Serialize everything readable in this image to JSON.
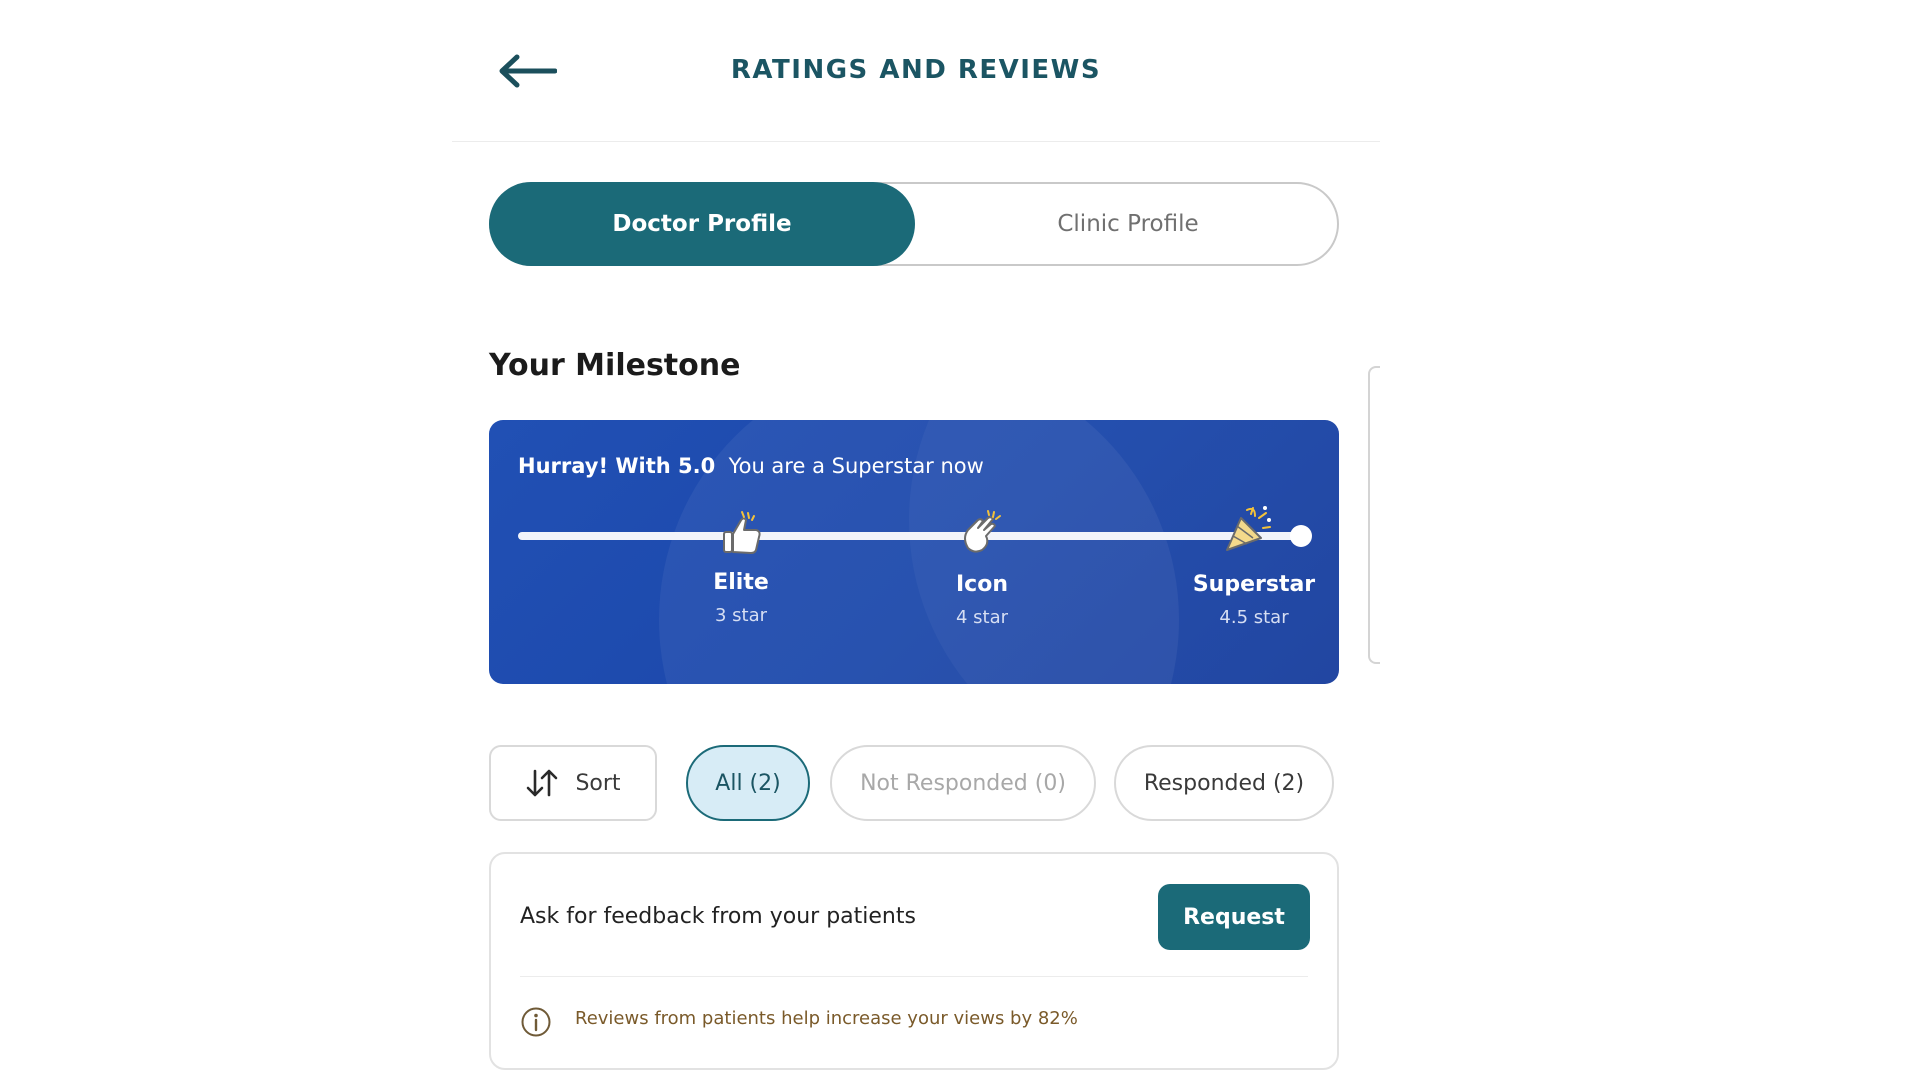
{
  "header": {
    "title": "RATINGS AND REVIEWS",
    "back_icon": "arrow-left-icon"
  },
  "tabs": [
    {
      "label": "Doctor Profile",
      "active": true
    },
    {
      "label": "Clinic Profile",
      "active": false
    }
  ],
  "milestone": {
    "section_title": "Your Milestone",
    "banner_prefix": "Hurray! With 5.0",
    "banner_suffix": "You are a Superstar now",
    "levels": [
      {
        "name": "Elite",
        "sub": "3 star",
        "icon": "thumbs-up-icon"
      },
      {
        "name": "Icon",
        "sub": "4 star",
        "icon": "clapping-hands-icon"
      },
      {
        "name": "Superstar",
        "sub": "4.5 star",
        "icon": "party-popper-icon"
      }
    ]
  },
  "filters": {
    "sort_label": "Sort",
    "sort_icon": "sort-arrows-icon",
    "chips": [
      {
        "label": "All (2)",
        "selected": true
      },
      {
        "label": "Not Responded (0)",
        "selected": false
      },
      {
        "label": "Responded (2)",
        "selected": false
      }
    ]
  },
  "feedback": {
    "prompt": "Ask for feedback from your patients",
    "button_label": "Request",
    "info_icon": "info-circle-icon",
    "info_text": "Reviews from patients help increase your views by 82%"
  },
  "colors": {
    "primary": "#1b6a78",
    "banner": "#1f4db0",
    "title": "#1b5563"
  }
}
